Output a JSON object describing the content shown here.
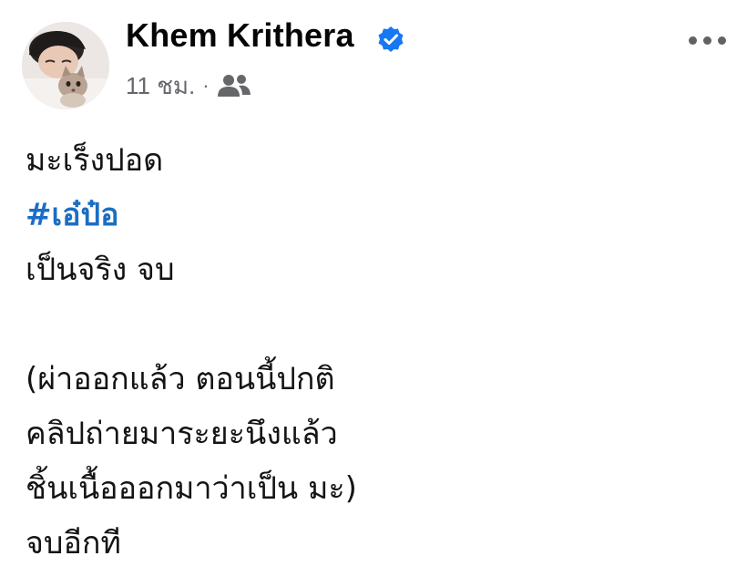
{
  "author": {
    "name": "Khem Krithera",
    "verified": true,
    "avatar_icon": "profile-photo-with-cat"
  },
  "meta": {
    "timestamp": "11 ชม.",
    "separator": "·",
    "audience_icon": "friends-icon"
  },
  "post": {
    "line1": "มะเร็งปอด",
    "hashtag": "#เอ๋ป๋อ",
    "line3": "เป็นจริง จบ",
    "line5": "(ผ่าออกแล้ว ตอนนี้ปกติ",
    "line6": "คลิปถ่ายมาระยะนึงแล้ว",
    "line7": "ชิ้นเนื้อออกมาว่าเป็น มะ)",
    "line8": "จบอีกที"
  },
  "colors": {
    "hashtag": "#1b6ec2",
    "verified_badge": "#1877f2",
    "meta_text": "#65676b"
  }
}
